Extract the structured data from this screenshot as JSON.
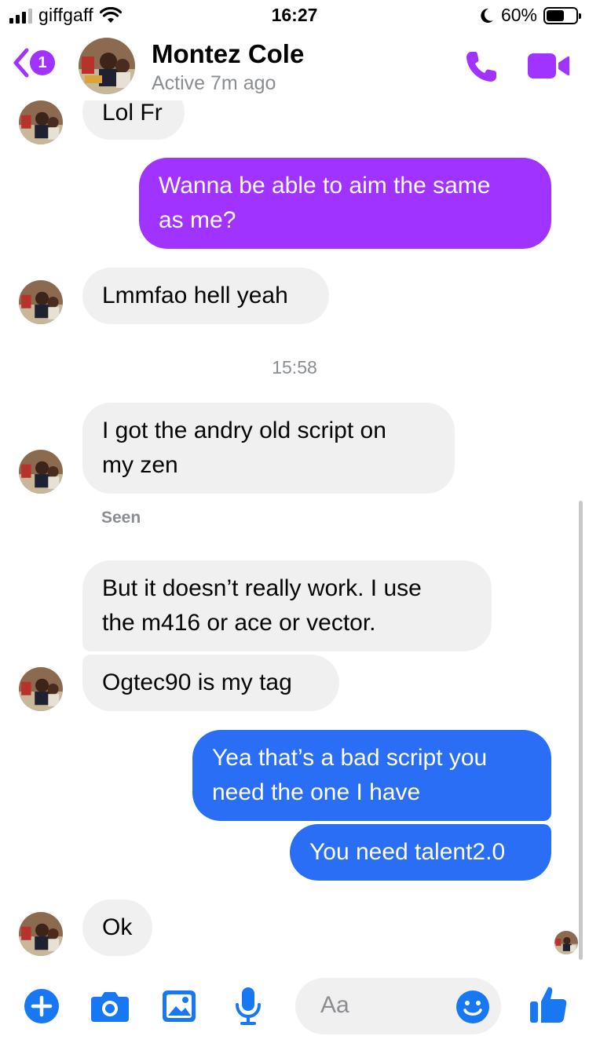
{
  "status_bar": {
    "carrier": "giffgaff",
    "time": "16:27",
    "battery_percent": "60%",
    "battery_level": 0.6
  },
  "header": {
    "back_badge_count": "1",
    "contact_name": "Montez Cole",
    "contact_status": "Active 7m ago"
  },
  "messages": {
    "m1": "Lol Fr",
    "m2_line1": "Wanna be able to aim the same",
    "m2_line2": "as me?",
    "m3": "Lmmfao hell yeah",
    "timestamp": "15:58",
    "m4_line1": "I got the andry old script on",
    "m4_line2": "my zen",
    "seen": "Seen",
    "m5_line1": "But it doesn’t really work. I use",
    "m5_line2": "the m416 or ace or vector.",
    "m6": "Ogtec90 is my tag",
    "m7_line1": "Yea that’s a bad script you",
    "m7_line2": "need the one I have",
    "m8": "You need talent2.0",
    "m9": "Ok"
  },
  "composer": {
    "placeholder": "Aa"
  },
  "colors": {
    "accent_purple": "#a033ff",
    "outgoing_purple": "#a033ff",
    "outgoing_blue": "#2a6ef5",
    "incoming_gray": "#f0f0f0",
    "composer_blue": "#1877f2"
  },
  "icons": {
    "back": "chevron-left-icon",
    "call": "phone-icon",
    "video": "video-camera-icon",
    "plus": "plus-icon",
    "camera": "camera-icon",
    "gallery": "image-icon",
    "mic": "microphone-icon",
    "emoji": "smiley-icon",
    "like": "thumbs-up-icon"
  }
}
